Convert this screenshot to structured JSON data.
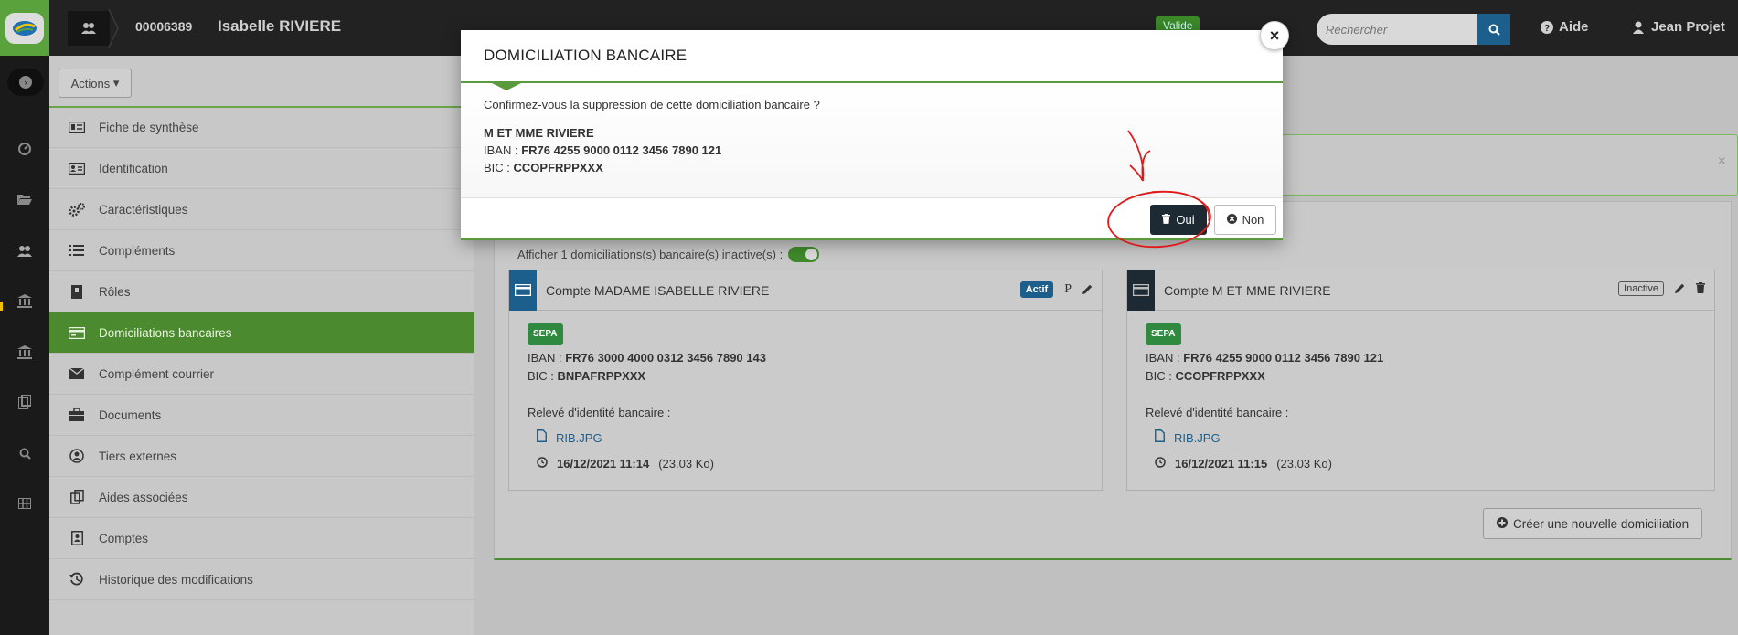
{
  "header": {
    "record_id": "00006389",
    "record_name": "Isabelle RIVIERE",
    "status_badge": "Valide",
    "search_placeholder": "Rechercher",
    "help_label": "Aide",
    "user_label": "Jean Projet"
  },
  "sidebar": {
    "actions_label": "Actions",
    "items": [
      {
        "label": "Fiche de synthèse",
        "icon": "id-card-icon"
      },
      {
        "label": "Identification",
        "icon": "id-badge-icon"
      },
      {
        "label": "Caractéristiques",
        "icon": "cogs-icon"
      },
      {
        "label": "Compléments",
        "icon": "list-icon"
      },
      {
        "label": "Rôles",
        "icon": "book-icon"
      },
      {
        "label": "Domiciliations bancaires",
        "icon": "credit-card-icon",
        "active": true
      },
      {
        "label": "Complément courrier",
        "icon": "envelope-icon"
      },
      {
        "label": "Documents",
        "icon": "briefcase-icon"
      },
      {
        "label": "Tiers externes",
        "icon": "user-circle-icon"
      },
      {
        "label": "Aides associées",
        "icon": "copy-icon"
      },
      {
        "label": "Comptes",
        "icon": "account-icon"
      },
      {
        "label": "Historique des modifications",
        "icon": "history-icon"
      }
    ]
  },
  "main": {
    "inactive_toggle_label": "Afficher 1 domiciliations(s) bancaire(s) inactive(s) :",
    "cards": [
      {
        "title": "Compte MADAME ISABELLE RIVIERE",
        "status": "Actif",
        "principal_marker": "P",
        "sepa": "SEPA",
        "iban_label": "IBAN :",
        "iban": "FR76 3000 4000 0312 3456 7890 143",
        "bic_label": "BIC :",
        "bic": "BNPAFRPPXXX",
        "rib_label": "Relevé d'identité bancaire :",
        "file_name": "RIB.JPG",
        "file_date": "16/12/2021 11:14",
        "file_size": "(23.03 Ko)"
      },
      {
        "title": "Compte M ET MME RIVIERE",
        "status": "Inactive",
        "sepa": "SEPA",
        "iban_label": "IBAN :",
        "iban": "FR76 4255 9000 0112 3456 7890 121",
        "bic_label": "BIC :",
        "bic": "CCOPFRPPXXX",
        "rib_label": "Relevé d'identité bancaire :",
        "file_name": "RIB.JPG",
        "file_date": "16/12/2021 11:15",
        "file_size": "(23.03 Ko)"
      }
    ],
    "create_label": "Créer une nouvelle domiciliation"
  },
  "modal": {
    "title": "DOMICILIATION BANCAIRE",
    "question": "Confirmez-vous la suppression de cette domiciliation bancaire ?",
    "holder": "M ET MME RIVIERE",
    "iban_label": "IBAN :",
    "iban": "FR76 4255 9000 0112 3456 7890 121",
    "bic_label": "BIC :",
    "bic": "CCOPFRPPXXX",
    "yes_label": "Oui",
    "no_label": "Non",
    "close_symbol": "×"
  },
  "colors": {
    "brand_green": "#4b8a2e",
    "primary_blue": "#1d5f8c",
    "dark_button": "#1e2a33",
    "annotation_red": "#e01a1a"
  }
}
